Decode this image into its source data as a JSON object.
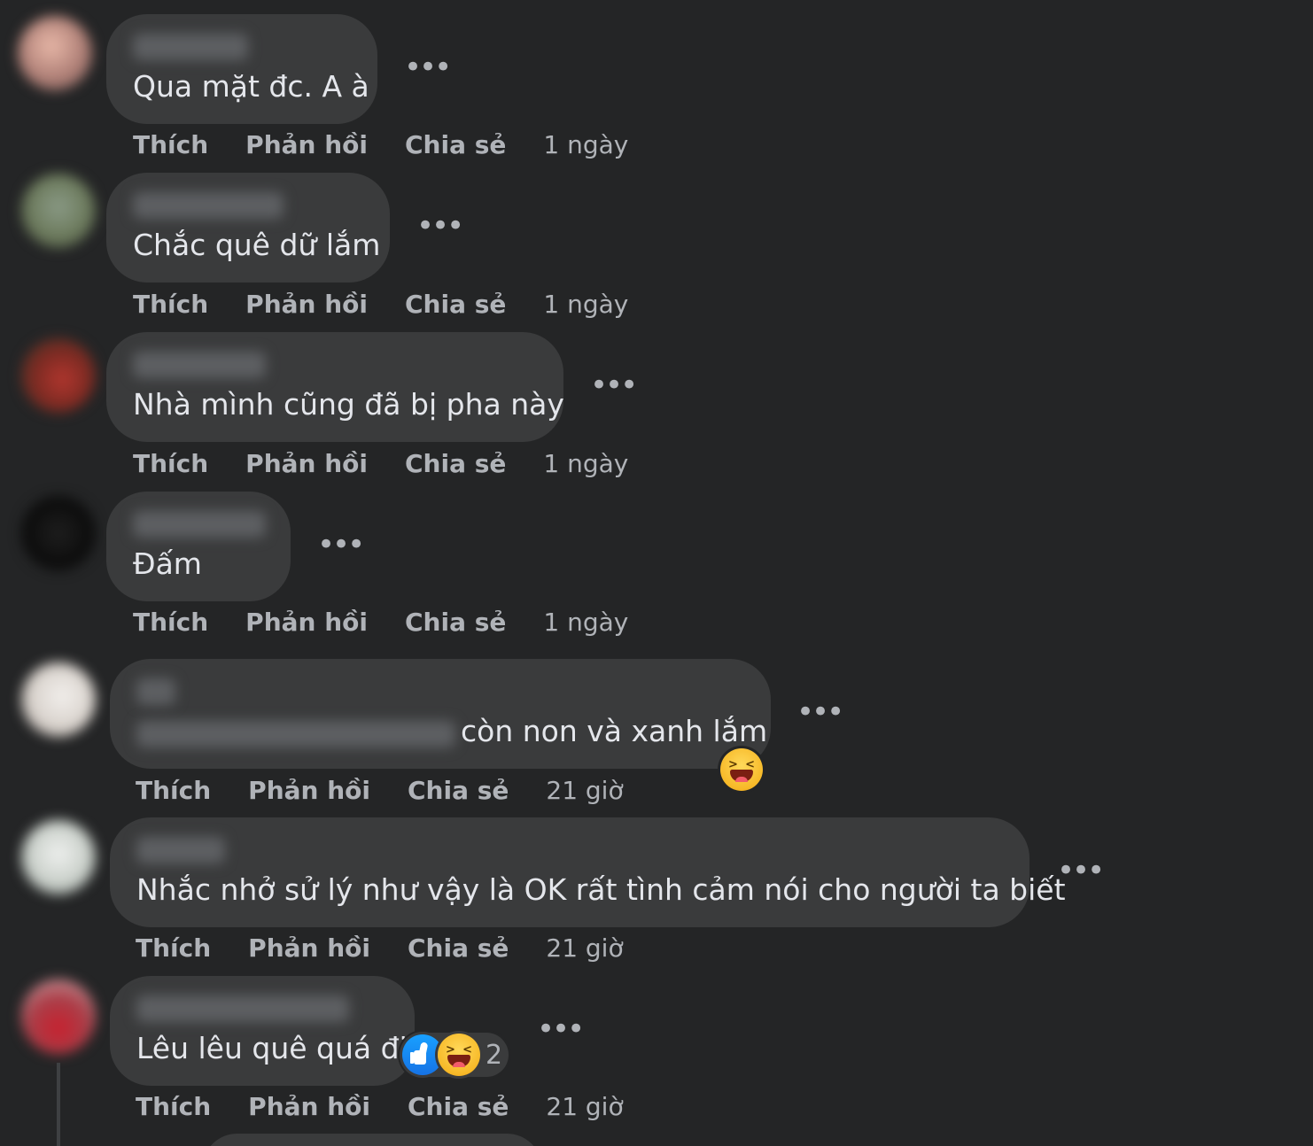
{
  "comments": [
    {
      "text": "Qua mặt đc. A à",
      "like": "Thích",
      "reply": "Phản hồi",
      "share": "Chia sẻ",
      "time": "1 ngày"
    },
    {
      "text": "Chắc quê dữ lắm",
      "like": "Thích",
      "reply": "Phản hồi",
      "share": "Chia sẻ",
      "time": "1 ngày"
    },
    {
      "text": "Nhà mình cũng đã bị pha này",
      "like": "Thích",
      "reply": "Phản hồi",
      "share": "Chia sẻ",
      "time": "1 ngày"
    },
    {
      "text": "Đấm",
      "like": "Thích",
      "reply": "Phản hồi",
      "share": "Chia sẻ",
      "time": "1 ngày"
    },
    {
      "text": "còn non và xanh lắm",
      "like": "Thích",
      "reply": "Phản hồi",
      "share": "Chia sẻ",
      "time": "21 giờ",
      "reaction_icons": [
        "haha-emoji"
      ]
    },
    {
      "text": "Nhắc nhở sử lý như vậy là OK rất tình cảm nói cho người ta biết",
      "like": "Thích",
      "reply": "Phản hồi",
      "share": "Chia sẻ",
      "time": "21 giờ"
    },
    {
      "text": "Lêu lêu quê quá đi",
      "like": "Thích",
      "reply": "Phản hồi",
      "share": "Chia sẻ",
      "time": "21 giờ",
      "reaction_icons": [
        "like-emoji",
        "haha-emoji"
      ],
      "reaction_count": "2"
    }
  ],
  "more_icon": "ellipsis-icon",
  "colors": {
    "background": "#242526",
    "bubble": "#3a3b3c",
    "text": "#e4e6eb",
    "secondary_text": "#b0b3b8",
    "like_blue": "#1877f2",
    "haha_yellow": "#f7b928"
  }
}
